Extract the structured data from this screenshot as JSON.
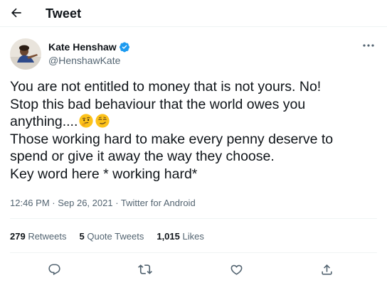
{
  "header": {
    "title": "Tweet",
    "back_icon": "arrow-left-icon"
  },
  "author": {
    "display_name": "Kate Henshaw",
    "handle": "@HenshawKate",
    "verified": true,
    "verified_color": "#1d9bf0",
    "more_icon": "more-dots-icon"
  },
  "tweet": {
    "lines": [
      "You are not entitled to money that is not yours. No!",
      "Stop this bad behaviour that the world owes you",
      "anything....",
      "Those working hard to make every penny deserve to",
      "spend or give it away the way they choose.",
      "Key word here * working hard*"
    ],
    "emojis": [
      "thinking-face-emoji",
      "smirking-face-emoji"
    ]
  },
  "meta": {
    "time": "12:46 PM",
    "separator": " · ",
    "date": "Sep 26, 2021",
    "source": "Twitter for Android"
  },
  "stats": {
    "retweets_count": "279",
    "retweets_label": " Retweets",
    "quotes_count": "5",
    "quotes_label": " Quote Tweets",
    "likes_count": "1,015",
    "likes_label": " Likes"
  },
  "actions": [
    "reply-icon",
    "retweet-icon",
    "like-icon",
    "share-icon"
  ],
  "colors": {
    "text": "#0f1419",
    "secondary": "#536471",
    "divider": "#eff3f4",
    "accent": "#1d9bf0"
  }
}
